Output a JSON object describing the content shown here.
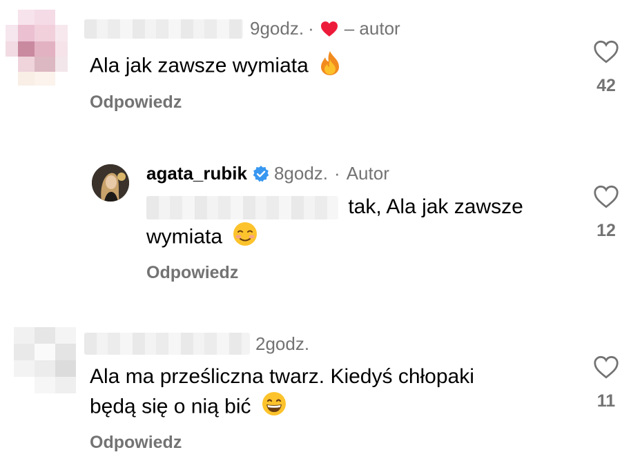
{
  "comments": [
    {
      "time": "9godz.",
      "dot": "·",
      "author_tag": "– autor",
      "text": "Ala jak zawsze wymiata",
      "emoji": "fire",
      "reply_label": "Odpowiedz",
      "likes": "42"
    },
    {
      "username": "agata_rubik",
      "verified": true,
      "time": "8godz.",
      "dot": "·",
      "author_tag": "Autor",
      "text_part1": "tak, Ala jak zawsze",
      "text_part2": "wymiata",
      "emoji": "smiling-face",
      "reply_label": "Odpowiedz",
      "likes": "12"
    },
    {
      "time": "2godz.",
      "text_line1": "Ala ma prześliczna twarz. Kiedyś chłopaki",
      "text_line2": "będą się o nią bić",
      "emoji": "grinning-face",
      "reply_label": "Odpowiedz",
      "likes": "11"
    }
  ],
  "colors": {
    "secondary": "#737373",
    "heart_red": "#ed1b3a",
    "verified_blue": "#3897f0"
  }
}
